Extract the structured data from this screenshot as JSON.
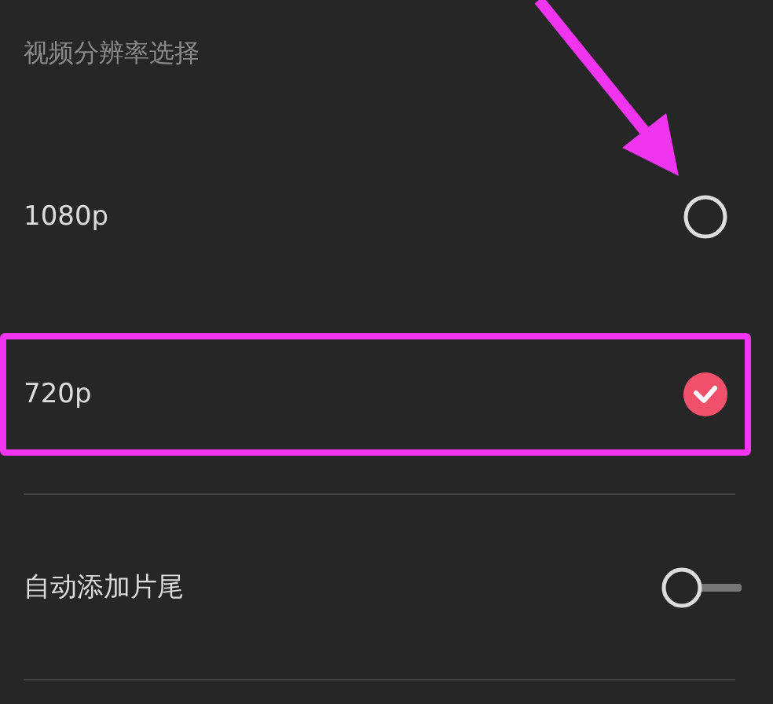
{
  "heading": "视频分辨率选择",
  "options": [
    {
      "label": "1080p",
      "selected": false,
      "highlighted": false
    },
    {
      "label": "720p",
      "selected": true,
      "highlighted": true
    }
  ],
  "switches": [
    {
      "label": "自动添加片尾",
      "on": false
    }
  ]
}
